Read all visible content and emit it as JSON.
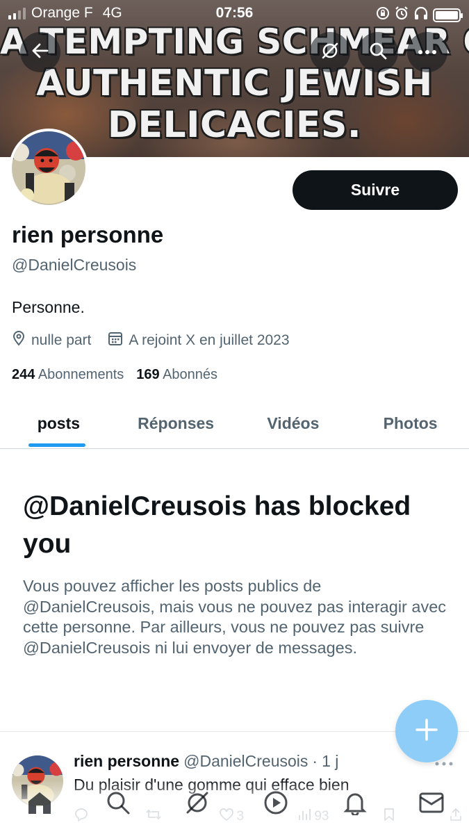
{
  "status_bar": {
    "carrier": "Orange F",
    "network": "4G",
    "time": "07:56"
  },
  "banner": {
    "line1": "A TEMPTING SCHMEAR OF",
    "line2": "AUTHENTIC JEWISH",
    "line3": "DELICACIES."
  },
  "header": {
    "back_icon": "arrow-left-icon",
    "grok_icon": "grok-icon",
    "search_icon": "search-icon",
    "more_icon": "more-icon"
  },
  "profile": {
    "follow_label": "Suivre",
    "display_name": "rien personne",
    "handle": "@DanielCreusois",
    "bio": "Personne.",
    "location": "nulle part",
    "joined": "A rejoint X en juillet 2023",
    "following_count": "244",
    "following_label": "Abonnements",
    "followers_count": "169",
    "followers_label": "Abonnés"
  },
  "tabs": [
    {
      "label": "posts",
      "active": true
    },
    {
      "label": "Réponses",
      "active": false
    },
    {
      "label": "Vidéos",
      "active": false
    },
    {
      "label": "Photos",
      "active": false
    }
  ],
  "blocked": {
    "title": "@DanielCreusois has blocked you",
    "body": "Vous pouvez afficher les posts publics de @DanielCreusois, mais vous ne pouvez pas interagir avec cette personne. Par ailleurs, vous ne pouvez pas suivre @DanielCreusois ni lui envoyer de messages."
  },
  "post": {
    "author_name": "rien personne",
    "author_handle": "@DanielCreusois",
    "separator": "·",
    "time": "1 j",
    "text": "Du plaisir d'une gomme qui efface bien",
    "reply_count": "",
    "repost_count": "",
    "like_count": "3",
    "view_count": "93"
  },
  "bottom_nav": [
    "home-icon",
    "search-icon",
    "grok-icon",
    "play-icon",
    "bell-icon",
    "mail-icon"
  ],
  "colors": {
    "accent": "#1d9bf0",
    "fab": "#8ecdf8",
    "text_primary": "#0f1419",
    "text_secondary": "#536471"
  }
}
